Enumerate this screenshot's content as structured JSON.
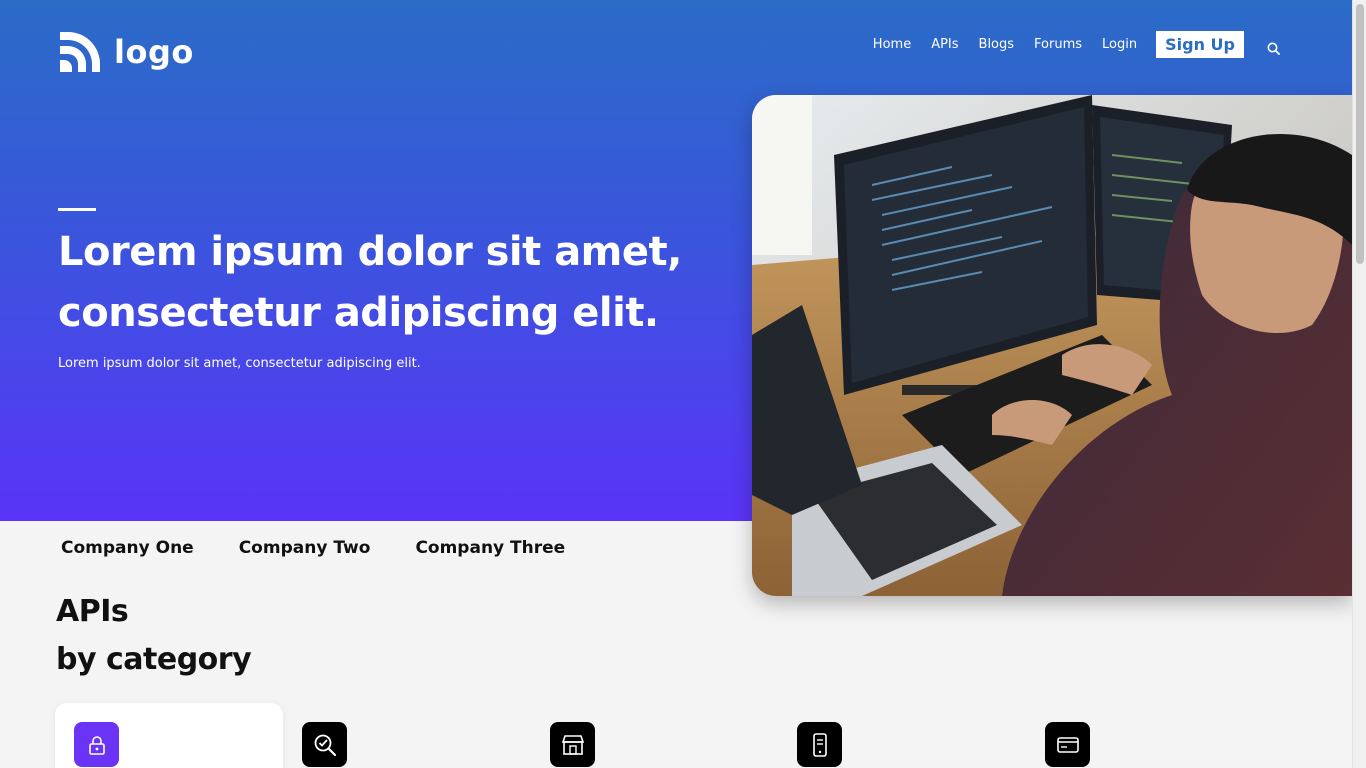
{
  "brand": {
    "logo_text": "logo",
    "accent": "#5a34f8",
    "gradient_top": "#2a6cc6",
    "gradient_bottom": "#5a34f8"
  },
  "nav": {
    "items": [
      "Home",
      "APIs",
      "Blogs",
      "Forums",
      "Login"
    ],
    "signup_label": "Sign Up",
    "search_icon": "search-icon"
  },
  "hero": {
    "title_line1": "Lorem ipsum dolor sit amet,",
    "title_line2": "consectetur adipiscing elit.",
    "subtitle": "Lorem ipsum dolor sit amet, consectetur adipiscing elit.",
    "image": "developer-at-desk-photo"
  },
  "companies": [
    "Company One",
    "Company Two",
    "Company Three"
  ],
  "section": {
    "title_line1": "APIs",
    "title_line2": "by category"
  },
  "categories": [
    {
      "icon": "lock-icon",
      "active": true
    },
    {
      "icon": "search-check-icon",
      "active": false
    },
    {
      "icon": "store-icon",
      "active": false
    },
    {
      "icon": "mobile-payment-icon",
      "active": false
    },
    {
      "icon": "credit-card-icon",
      "active": false
    }
  ]
}
